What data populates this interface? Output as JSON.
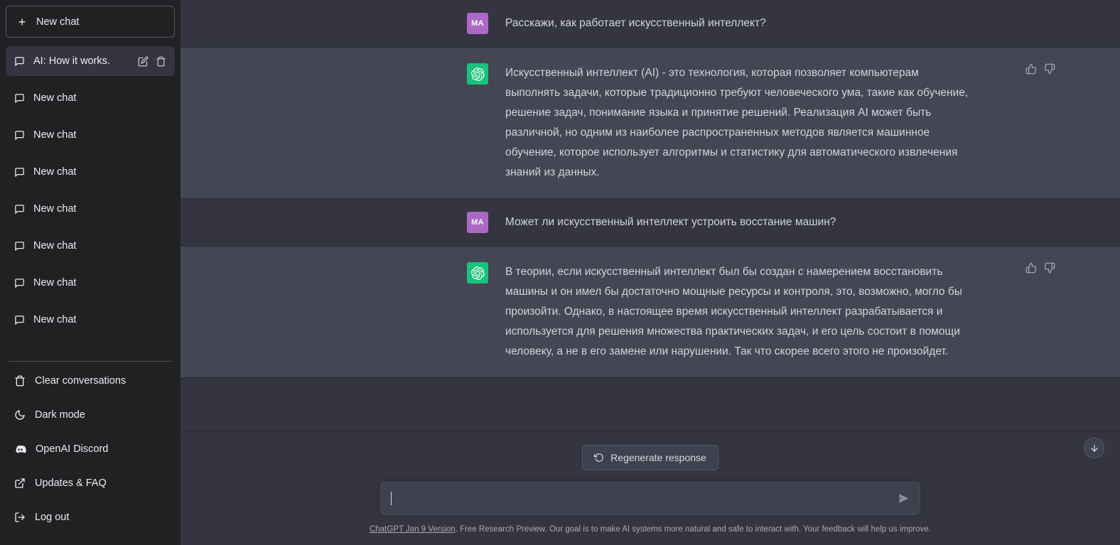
{
  "sidebar": {
    "new_chat_label": "New chat",
    "conversations": [
      {
        "label": "AI: How it works.",
        "active": true
      },
      {
        "label": "New chat",
        "active": false
      },
      {
        "label": "New chat",
        "active": false
      },
      {
        "label": "New chat",
        "active": false
      },
      {
        "label": "New chat",
        "active": false
      },
      {
        "label": "New chat",
        "active": false
      },
      {
        "label": "New chat",
        "active": false
      },
      {
        "label": "New chat",
        "active": false
      }
    ],
    "menu": [
      {
        "label": "Clear conversations",
        "icon": "trash-icon"
      },
      {
        "label": "Dark mode",
        "icon": "moon-icon"
      },
      {
        "label": "OpenAI Discord",
        "icon": "discord-icon"
      },
      {
        "label": "Updates & FAQ",
        "icon": "external-link-icon"
      },
      {
        "label": "Log out",
        "icon": "logout-icon"
      }
    ]
  },
  "conversation": {
    "user_avatar_initials": "MA",
    "messages": [
      {
        "role": "user",
        "text": "Расскажи, как работает искусственный интеллект?"
      },
      {
        "role": "assistant",
        "text": "Искусственный интеллект (AI) - это технология, которая позволяет компьютерам выполнять задачи, которые традиционно требуют человеческого ума, такие как обучение, решение задач, понимание языка и принятие решений. Реализация AI может быть различной, но одним из наиболее распространенных методов является машинное обучение, которое использует алгоритмы и статистику для автоматического извлечения знаний из данных."
      },
      {
        "role": "user",
        "text": "Может ли искусственный интеллект устроить восстание машин?"
      },
      {
        "role": "assistant",
        "text": "В теории, если искусственный интеллект был бы создан с намерением восстановить машины и он имел бы достаточно мощные ресурсы и контроля, это, возможно, могло бы произойти. Однако, в настоящее время искусственный интеллект разрабатывается и используется для решения множества практических задач, и его цель состоит в помощи человеку, а не в его замене или нарушении. Так что скорее всего этого не произойдет."
      }
    ]
  },
  "composer": {
    "regenerate_label": "Regenerate response",
    "input_value": "",
    "input_placeholder": ""
  },
  "footer": {
    "link_text": "ChatGPT Jan 9 Version",
    "rest_text": ". Free Research Preview. Our goal is to make AI systems more natural and safe to interact with. Your feedback will help us improve."
  },
  "colors": {
    "sidebar_bg": "#202123",
    "user_msg_bg": "#343541",
    "assistant_msg_bg": "#444654",
    "user_avatar_bg": "#ab68c4",
    "assistant_avatar_bg": "#19c37d",
    "text": "#d1d5db"
  }
}
